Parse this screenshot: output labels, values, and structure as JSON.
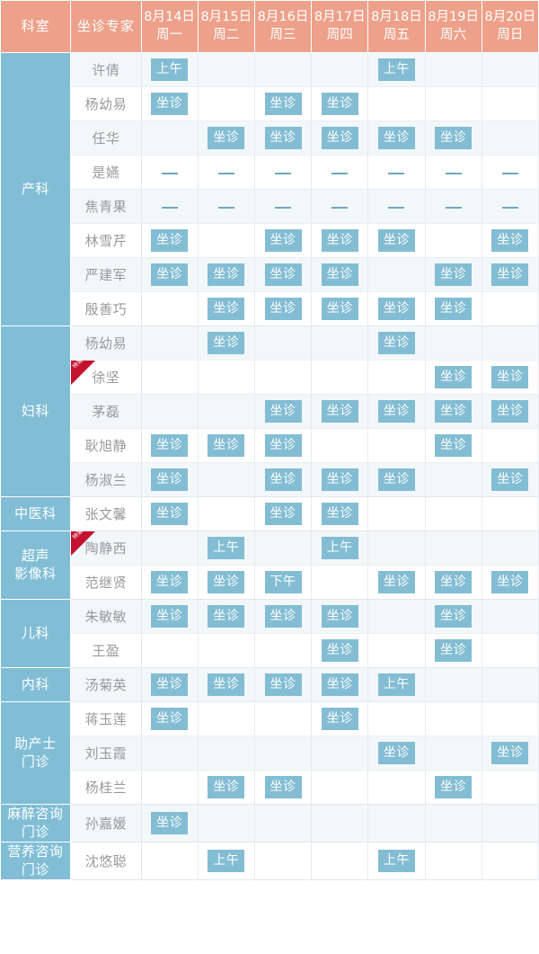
{
  "header": {
    "department_label": "科室",
    "doctor_label": "坐诊专家",
    "days": [
      {
        "date": "8月14日",
        "weekday": "周一"
      },
      {
        "date": "8月15日",
        "weekday": "周二"
      },
      {
        "date": "8月16日",
        "weekday": "周三"
      },
      {
        "date": "8月17日",
        "weekday": "周四"
      },
      {
        "date": "8月18日",
        "weekday": "周五"
      },
      {
        "date": "8月19日",
        "weekday": "周六"
      },
      {
        "date": "8月20日",
        "weekday": "周日"
      }
    ]
  },
  "badge": {
    "special_label": "特需"
  },
  "slot_labels": {
    "full_day": "坐诊",
    "morning": "上午",
    "afternoon": "下午",
    "none": "—"
  },
  "colors": {
    "header_bg": "#eda18a",
    "department_bg": "#81bed6",
    "slot_bg": "#83bdd3",
    "ribbon_bg": "#c4122f",
    "stripe_bg": "#f2f7fa",
    "row_bg": "#ffffff",
    "text_gray": "#9a9a9a"
  },
  "departments": [
    {
      "name": "产科",
      "doctors": [
        {
          "name": "许倩",
          "special": false,
          "slots": [
            "上午",
            "",
            "",
            "",
            "上午",
            "",
            ""
          ]
        },
        {
          "name": "杨幼易",
          "special": false,
          "slots": [
            "坐诊",
            "",
            "坐诊",
            "坐诊",
            "",
            "",
            ""
          ]
        },
        {
          "name": "任华",
          "special": false,
          "slots": [
            "",
            "坐诊",
            "坐诊",
            "坐诊",
            "坐诊",
            "坐诊",
            ""
          ]
        },
        {
          "name": "是嬿",
          "special": false,
          "slots": [
            "—",
            "—",
            "—",
            "—",
            "—",
            "—",
            "—"
          ]
        },
        {
          "name": "焦青果",
          "special": false,
          "slots": [
            "—",
            "—",
            "—",
            "—",
            "—",
            "—",
            "—"
          ]
        },
        {
          "name": "林雪芹",
          "special": false,
          "slots": [
            "坐诊",
            "",
            "坐诊",
            "坐诊",
            "坐诊",
            "",
            "坐诊"
          ]
        },
        {
          "name": "严建军",
          "special": false,
          "slots": [
            "坐诊",
            "坐诊",
            "坐诊",
            "坐诊",
            "",
            "坐诊",
            "坐诊"
          ]
        },
        {
          "name": "殷善巧",
          "special": false,
          "slots": [
            "",
            "坐诊",
            "坐诊",
            "坐诊",
            "坐诊",
            "坐诊",
            ""
          ]
        }
      ]
    },
    {
      "name": "妇科",
      "doctors": [
        {
          "name": "杨幼易",
          "special": false,
          "slots": [
            "",
            "坐诊",
            "",
            "",
            "坐诊",
            "",
            ""
          ]
        },
        {
          "name": "徐坚",
          "special": true,
          "slots": [
            "",
            "",
            "",
            "",
            "",
            "坐诊",
            "坐诊"
          ]
        },
        {
          "name": "茅磊",
          "special": false,
          "slots": [
            "",
            "",
            "坐诊",
            "坐诊",
            "坐诊",
            "坐诊",
            "坐诊"
          ]
        },
        {
          "name": "耿旭静",
          "special": false,
          "slots": [
            "坐诊",
            "坐诊",
            "坐诊",
            "",
            "",
            "坐诊",
            ""
          ]
        },
        {
          "name": "杨淑兰",
          "special": false,
          "slots": [
            "坐诊",
            "",
            "坐诊",
            "坐诊",
            "坐诊",
            "",
            "坐诊"
          ]
        }
      ]
    },
    {
      "name": "中医科",
      "doctors": [
        {
          "name": "张文馨",
          "special": false,
          "slots": [
            "坐诊",
            "",
            "坐诊",
            "坐诊",
            "",
            "",
            ""
          ]
        }
      ]
    },
    {
      "name": "超声\n影像科",
      "doctors": [
        {
          "name": "陶静西",
          "special": true,
          "slots": [
            "",
            "上午",
            "",
            "上午",
            "",
            "",
            ""
          ]
        },
        {
          "name": "范继贤",
          "special": false,
          "slots": [
            "坐诊",
            "坐诊",
            "下午",
            "",
            "坐诊",
            "坐诊",
            "坐诊"
          ]
        }
      ]
    },
    {
      "name": "儿科",
      "doctors": [
        {
          "name": "朱敏敏",
          "special": false,
          "slots": [
            "坐诊",
            "坐诊",
            "坐诊",
            "坐诊",
            "",
            "坐诊",
            ""
          ]
        },
        {
          "name": "王盈",
          "special": false,
          "slots": [
            "",
            "",
            "",
            "坐诊",
            "",
            "坐诊",
            ""
          ]
        }
      ]
    },
    {
      "name": "内科",
      "doctors": [
        {
          "name": "汤菊英",
          "special": false,
          "slots": [
            "坐诊",
            "坐诊",
            "坐诊",
            "坐诊",
            "上午",
            "",
            ""
          ]
        }
      ]
    },
    {
      "name": "助产士\n门诊",
      "doctors": [
        {
          "name": "蒋玉莲",
          "special": false,
          "slots": [
            "坐诊",
            "",
            "",
            "坐诊",
            "",
            "",
            ""
          ]
        },
        {
          "name": "刘玉霞",
          "special": false,
          "slots": [
            "",
            "",
            "",
            "",
            "坐诊",
            "",
            "坐诊"
          ]
        },
        {
          "name": "杨桂兰",
          "special": false,
          "slots": [
            "",
            "坐诊",
            "坐诊",
            "",
            "",
            "坐诊",
            ""
          ]
        }
      ]
    },
    {
      "name": "麻醉咨询\n门诊",
      "doctors": [
        {
          "name": "孙嘉媛",
          "special": false,
          "slots": [
            "坐诊",
            "",
            "",
            "",
            "",
            "",
            ""
          ]
        }
      ]
    },
    {
      "name": "营养咨询\n门诊",
      "doctors": [
        {
          "name": "沈悠聪",
          "special": false,
          "slots": [
            "",
            "上午",
            "",
            "",
            "上午",
            "",
            ""
          ]
        }
      ]
    }
  ]
}
